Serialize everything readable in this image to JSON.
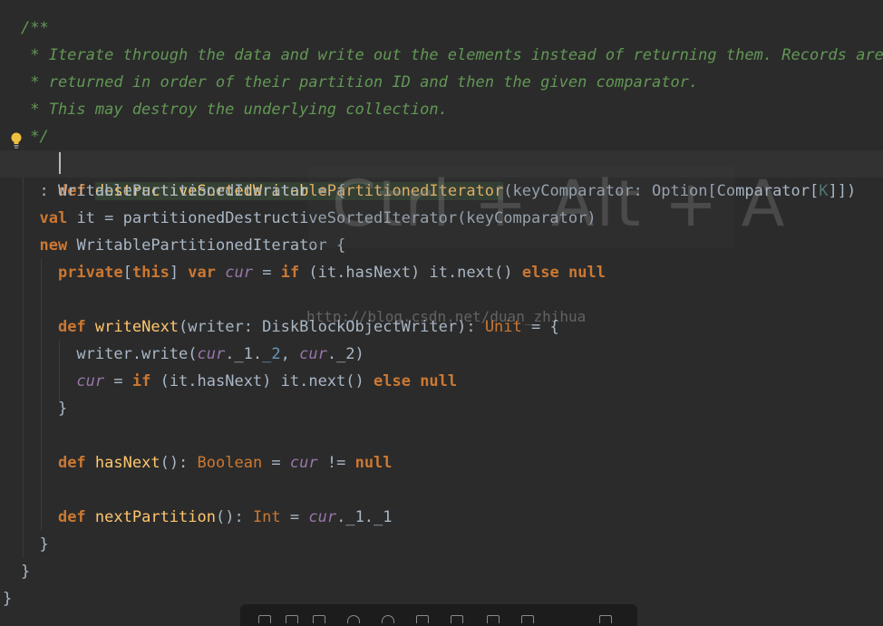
{
  "code_lines": [
    "/**",
    " * Iterate through the data and write out the elements instead of returning them. Records are",
    " * returned in order of their partition ID and then the given comparator.",
    " * This may destroy the underlying collection.",
    " */",
    "def destructiveSortedWritablePartitionedIterator(keyComparator: Option[Comparator[K]])",
    "  : WritablePartitionedIterator = {",
    "  val it = partitionedDestructiveSortedIterator(keyComparator)",
    "  new WritablePartitionedIterator {",
    "    private[this] var cur = if (it.hasNext) it.next() else null",
    "",
    "    def writeNext(writer: DiskBlockObjectWriter): Unit = {",
    "      writer.write(cur._1._2, cur._2)",
    "      cur = if (it.hasNext) it.next() else null",
    "    }",
    "",
    "    def hasNext(): Boolean = cur != null",
    "",
    "    def nextPartition(): Int = cur._1._1",
    "  }",
    "}",
    "}"
  ],
  "overlay": {
    "shortcut_text": "Ctrl + Alt + A"
  },
  "watermark": {
    "text": "http://blog.csdn.net/duan_zhihua"
  },
  "colors": {
    "background": "#2b2b2b",
    "keyword": "#cc7832",
    "comment": "#629755",
    "function": "#ffc66d",
    "field": "#9876aa",
    "text": "#a9b7c6"
  },
  "icons": [
    "lightbulb-icon"
  ]
}
